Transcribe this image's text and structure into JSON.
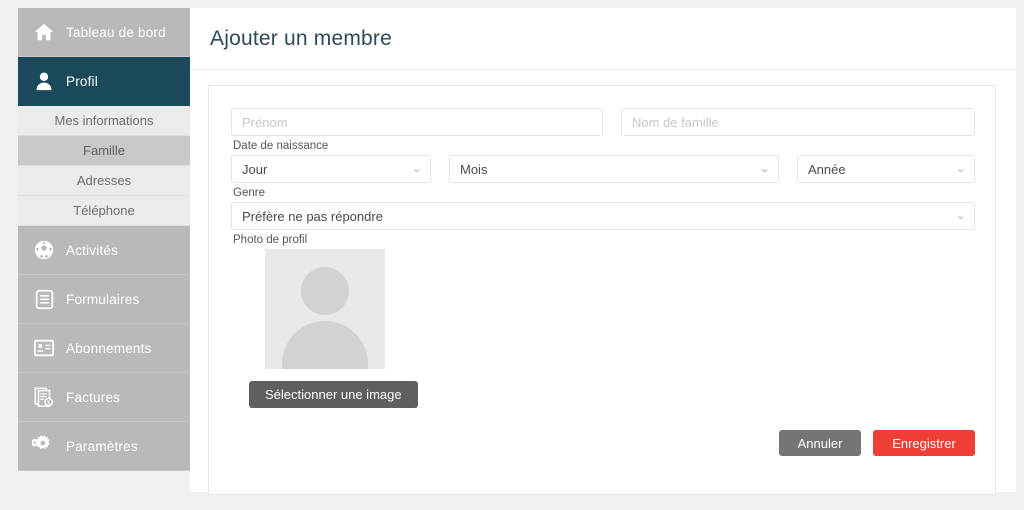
{
  "sidebar": {
    "items": [
      {
        "label": "Tableau de bord",
        "icon": "home-icon",
        "active": false
      },
      {
        "label": "Profil",
        "icon": "user-icon",
        "active": true
      },
      {
        "label": "Activités",
        "icon": "soccer-ball-icon",
        "active": false
      },
      {
        "label": "Formulaires",
        "icon": "form-document-icon",
        "active": false
      },
      {
        "label": "Abonnements",
        "icon": "id-card-icon",
        "active": false
      },
      {
        "label": "Factures",
        "icon": "invoice-dollar-icon",
        "active": false
      },
      {
        "label": "Paramètres",
        "icon": "gears-icon",
        "active": false
      }
    ],
    "sub_items": [
      {
        "label": "Mes informations",
        "active": false
      },
      {
        "label": "Famille",
        "active": true
      },
      {
        "label": "Adresses",
        "active": false
      },
      {
        "label": "Téléphone",
        "active": false
      }
    ]
  },
  "header": {
    "title": "Ajouter un membre"
  },
  "form": {
    "first_name": {
      "placeholder": "Prénom",
      "value": ""
    },
    "last_name": {
      "placeholder": "Nom de famille",
      "value": ""
    },
    "birthdate_label": "Date de naissance",
    "day": {
      "value": "Jour"
    },
    "month": {
      "value": "Mois"
    },
    "year": {
      "value": "Année"
    },
    "gender_label": "Genre",
    "gender": {
      "value": "Préfère ne pas répondre"
    },
    "photo_label": "Photo de profil",
    "select_image_label": "Sélectionner une image"
  },
  "actions": {
    "cancel_label": "Annuler",
    "save_label": "Enregistrer"
  },
  "colors": {
    "accent_teal": "#1b4a5a",
    "save_red": "#ef3e36",
    "sidebar_gray": "#b9b9b9",
    "sub_item_gray": "#ebebeb",
    "sub_item_active": "#c8c8c8",
    "title_slate": "#2d4a57"
  },
  "icons": {
    "chevron_down": "⌄"
  }
}
